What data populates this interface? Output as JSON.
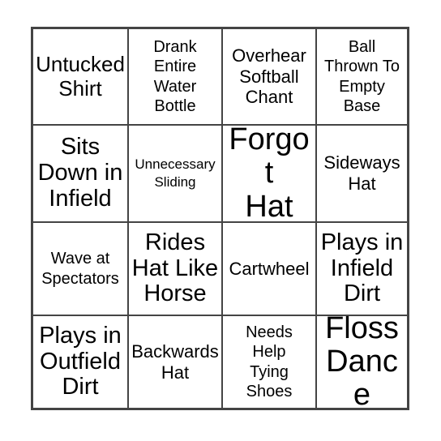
{
  "card": {
    "type": "bingo-card",
    "rows": 4,
    "columns": 4,
    "border_color": "#444444",
    "text_color": "#000000",
    "background_color": "#ffffff",
    "cells": [
      {
        "text": "Untucked\nShirt",
        "size": "lg"
      },
      {
        "text": "Drank\nEntire\nWater\nBottle",
        "size": "sm"
      },
      {
        "text": "Overhear\nSoftball\nChant",
        "size": "md"
      },
      {
        "text": "Ball\nThrown To\nEmpty\nBase",
        "size": "sm"
      },
      {
        "text": "Sits\nDown in\nInfield",
        "size": "xl"
      },
      {
        "text": "Unnecessary\nSliding",
        "size": "xs"
      },
      {
        "text": "Forgot\nHat",
        "size": "xxl"
      },
      {
        "text": "Sideways\nHat",
        "size": "md"
      },
      {
        "text": "Wave at\nSpectators",
        "size": "sm"
      },
      {
        "text": "Rides\nHat Like\nHorse",
        "size": "xl"
      },
      {
        "text": "Cartwheel",
        "size": "md"
      },
      {
        "text": "Plays in\nInfield\nDirt",
        "size": "xl"
      },
      {
        "text": "Plays in\nOutfield\nDirt",
        "size": "xl"
      },
      {
        "text": "Backwards\nHat",
        "size": "md"
      },
      {
        "text": "Needs\nHelp\nTying\nShoes",
        "size": "sm"
      },
      {
        "text": "Floss\nDance",
        "size": "xxl"
      }
    ]
  }
}
